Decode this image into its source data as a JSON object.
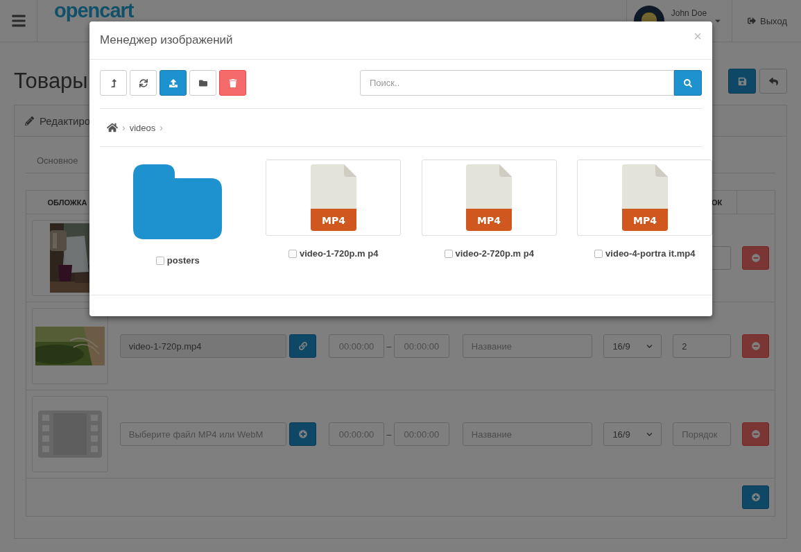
{
  "header": {
    "logo": "opencart",
    "user": "John Doe",
    "logout": "Выход"
  },
  "page": {
    "title": "Товары"
  },
  "panel": {
    "heading": "Редактиро",
    "tabs": [
      {
        "label": "Основное",
        "selected": false
      }
    ]
  },
  "table": {
    "columns": [
      "ОБЛОЖКА",
      "ОК"
    ],
    "rows": [
      {
        "kind": "covered"
      },
      {
        "kind": "full",
        "file": {
          "value": "video-1-720p.mp4"
        },
        "file_button": {
          "kind": "link"
        },
        "start": {
          "placeholder": "00:00:00"
        },
        "dash": "–",
        "end": {
          "placeholder": "00:00:00"
        },
        "title": {
          "placeholder": "Название"
        },
        "ratio": "16/9",
        "order": {
          "value": "2"
        }
      },
      {
        "kind": "full",
        "thumbnail": {
          "kind": "placeholder"
        },
        "file": {
          "placeholder": "Выберите файл MP4 или WebM"
        },
        "file_button": {
          "kind": "add"
        },
        "start": {
          "placeholder": "00:00:00"
        },
        "dash": "–",
        "end": {
          "placeholder": "00:00:00"
        },
        "title": {
          "placeholder": "Название"
        },
        "ratio": "16/9",
        "order": {
          "placeholder": "Порядок"
        }
      }
    ]
  },
  "modal": {
    "title": "Менеджер изображений",
    "close": "×",
    "toolbar": [
      {
        "kind": "parent"
      },
      {
        "kind": "refresh"
      },
      {
        "kind": "upload"
      },
      {
        "kind": "folder"
      },
      {
        "kind": "delete"
      }
    ],
    "search": {
      "placeholder": "Поиск.."
    },
    "breadcrumb": {
      "separator": "›",
      "items": [
        "videos"
      ]
    },
    "items": [
      {
        "kind": "folder",
        "name": "posters",
        "checked": false
      },
      {
        "kind": "file",
        "badge": "MP4",
        "name": "video-1-720p.m p4",
        "checked": false
      },
      {
        "kind": "file",
        "badge": "MP4",
        "name": "video-2-720p.m p4",
        "checked": false
      },
      {
        "kind": "file",
        "badge": "MP4",
        "name": "video-4-portra it.mp4",
        "checked": false
      }
    ]
  }
}
